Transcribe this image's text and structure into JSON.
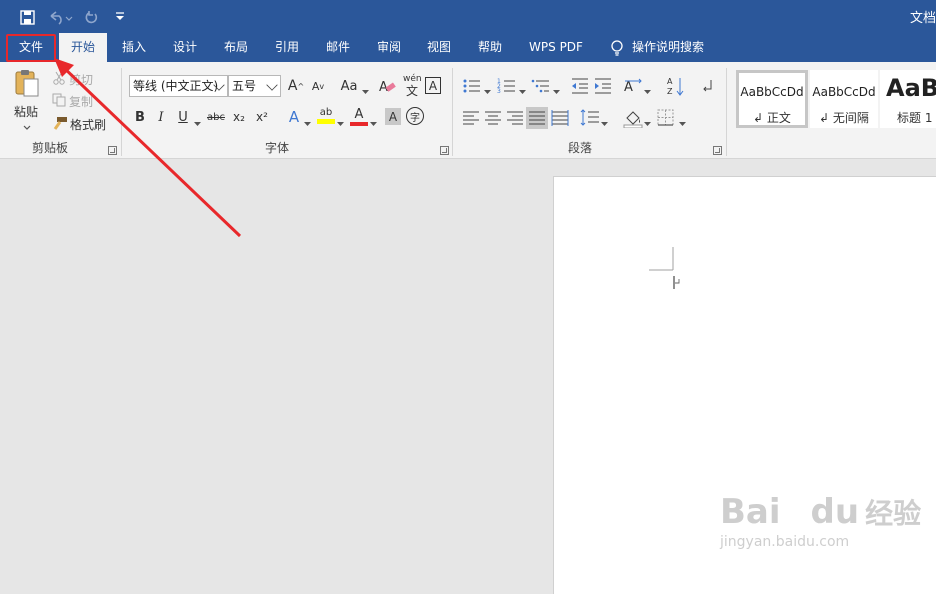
{
  "title_bar": {
    "doc_title": "文档",
    "colors": {
      "accent": "#2b579a",
      "ribbon_bg": "#f3f3f3",
      "highlight": "#e8282b"
    }
  },
  "quick_access": {
    "icons": [
      "save-icon",
      "undo-icon",
      "redo-icon",
      "customize-icon"
    ]
  },
  "tabs": [
    {
      "label": "文件"
    },
    {
      "label": "开始"
    },
    {
      "label": "插入"
    },
    {
      "label": "设计"
    },
    {
      "label": "布局"
    },
    {
      "label": "引用"
    },
    {
      "label": "邮件"
    },
    {
      "label": "审阅"
    },
    {
      "label": "视图"
    },
    {
      "label": "帮助"
    },
    {
      "label": "WPS PDF"
    },
    {
      "label": "操作说明搜索"
    }
  ],
  "clipboard": {
    "paste": "粘贴",
    "cut": "剪切",
    "copy": "复制",
    "format_painter": "格式刷",
    "label": "剪贴板"
  },
  "font": {
    "font_name": "等线 (中文正文)",
    "font_size": "五号",
    "grow": "A",
    "shrink": "A",
    "change_case": "Aa",
    "phonetic_top": "wén",
    "phonetic_bottom": "文",
    "char_border": "A",
    "bold": "B",
    "italic": "I",
    "underline": "U",
    "strikethrough": "abc",
    "subscript": "x₂",
    "superscript": "x²",
    "text_effect": "A",
    "highlight": "ab",
    "font_color": "A",
    "char_shading": "A",
    "enclose": "字",
    "label": "字体"
  },
  "paragraph": {
    "label": "段落"
  },
  "styles": {
    "items": [
      {
        "sample": "AaBbCcDd",
        "name": "正文"
      },
      {
        "sample": "AaBbCcDd",
        "name": "无间隔"
      },
      {
        "sample": "AaB",
        "name": "标题 1"
      }
    ]
  },
  "watermark": {
    "brand": "Bai",
    "brand2": "du",
    "product": "经验",
    "url": "jingyan.baidu.com"
  }
}
